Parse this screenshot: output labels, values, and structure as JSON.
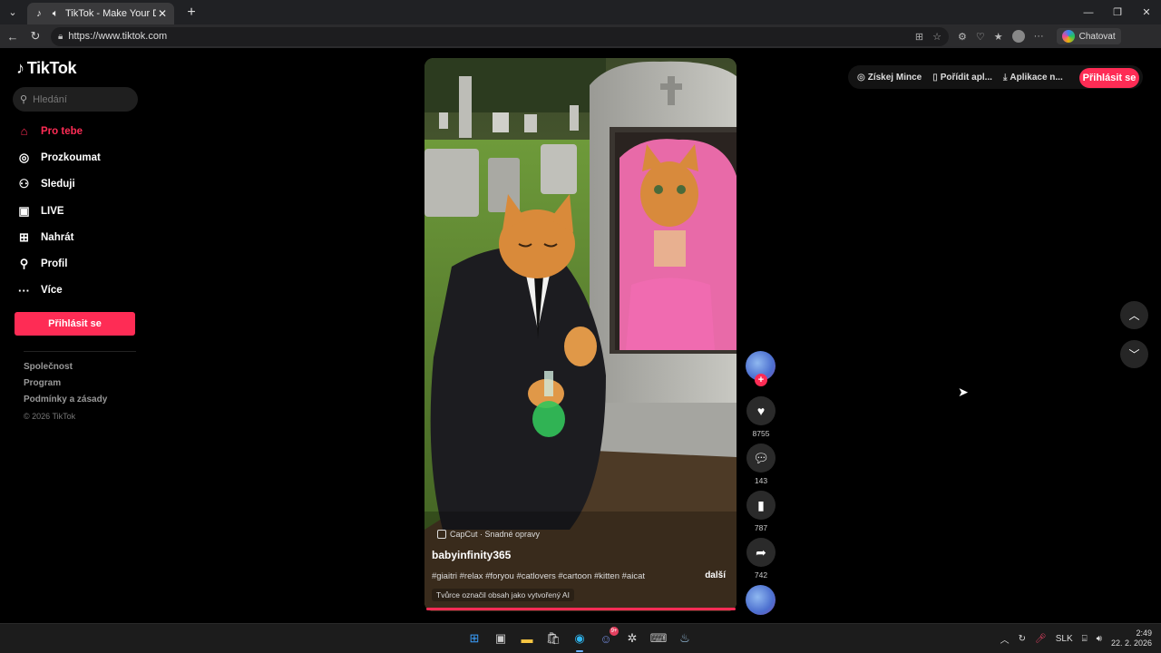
{
  "browser": {
    "tab_title": "TikTok - Make Your Day",
    "url": "https://www.tiktok.com",
    "copilot_label": "Chatovat"
  },
  "sidebar": {
    "logo_text": "TikTok",
    "search_placeholder": "Hledání",
    "nav": [
      {
        "label": "Pro tebe",
        "icon": "home-icon"
      },
      {
        "label": "Prozkoumat",
        "icon": "compass-icon"
      },
      {
        "label": "Sleduji",
        "icon": "following-icon"
      },
      {
        "label": "LIVE",
        "icon": "live-icon"
      },
      {
        "label": "Nahrát",
        "icon": "upload-icon"
      },
      {
        "label": "Profil",
        "icon": "profile-icon"
      },
      {
        "label": "Více",
        "icon": "more-icon"
      }
    ],
    "login_label": "Přihlásit se",
    "footer": {
      "company": "Společnost",
      "program": "Program",
      "terms": "Podmínky a zásady",
      "copyright": "© 2026 TikTok"
    }
  },
  "topbar": {
    "coins": "Získej Mince",
    "get_app": "Pořídit apl...",
    "desktop_app": "Aplikace n...",
    "login": "Přihlásit se"
  },
  "video": {
    "capcut_label": "CapCut · Snadné opravy",
    "author": "babyinfinity365",
    "tags": "#giaitri #relax #foryou #catlovers #cartoon #kitten #aicat",
    "more_label": "další",
    "ai_notice": "Tvůrce označil obsah jako vytvořený AI",
    "progress_fraction": 0.99
  },
  "actions": {
    "likes": "8755",
    "comments": "143",
    "saves": "787",
    "shares": "742"
  },
  "taskbar": {
    "lang": "SLK",
    "time": "2:49",
    "date": "22. 2. 2026",
    "discord_badge": "9+"
  },
  "colors": {
    "accent": "#fe2c55",
    "background": "#000000"
  }
}
